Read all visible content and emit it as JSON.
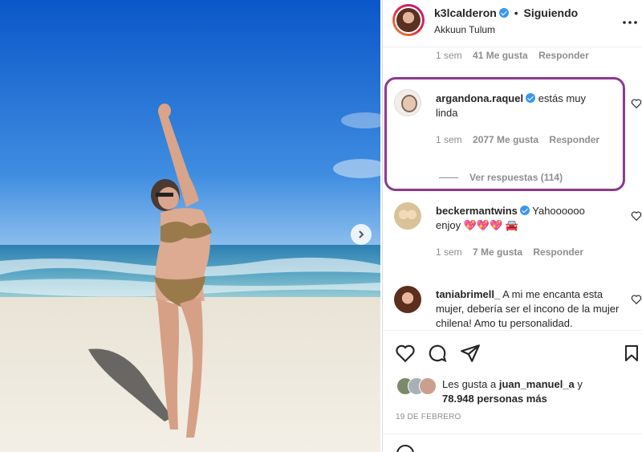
{
  "header": {
    "username": "k3lcalderon",
    "separator": "•",
    "follow_state": "Siguiendo",
    "location": "Akkuun Tulum",
    "more_icon": "more-horizontal-icon"
  },
  "prev_comment_meta": {
    "time": "1 sem",
    "likes": "41 Me gusta",
    "reply": "Responder"
  },
  "comments": [
    {
      "username": "argandona.raquel",
      "text": "estás muy linda",
      "time": "1 sem",
      "likes": "2077 Me gusta",
      "reply": "Responder",
      "view_replies": "Ver respuestas (114)",
      "highlight_color": "#8b3a8f"
    },
    {
      "username": "beckermantwins",
      "text": "Yahoooooo enjoy 💖💖💖 🚘",
      "time": "1 sem",
      "likes": "7 Me gusta",
      "reply": "Responder"
    },
    {
      "username": "taniabrimell_",
      "text": "A mi me encanta esta mujer, debería ser el incono de la mujer chilena! Amo tu personalidad.",
      "time": "",
      "likes": "",
      "reply": ""
    }
  ],
  "actions": {
    "like_icon": "heart-icon",
    "comment_icon": "comment-icon",
    "share_icon": "send-icon",
    "save_icon": "bookmark-icon"
  },
  "likes_summary": {
    "prefix": "Les gusta a",
    "user": "juan_manuel_a",
    "conj": "y",
    "count": "78.948 personas más"
  },
  "date": "19 DE FEBRERO",
  "colors": {
    "verified": "#3897f0",
    "highlight": "#8b3a8f",
    "text": "#262626",
    "muted": "#8e8e8e"
  }
}
